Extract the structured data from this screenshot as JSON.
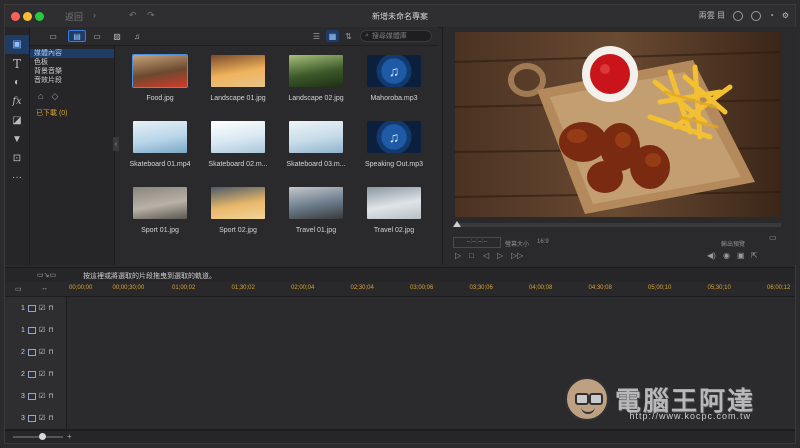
{
  "window": {
    "title": "新增未命名專案",
    "nav_back": "返回",
    "right_label": "兩雲 目",
    "icons": [
      "user-icon",
      "bell-icon",
      "gear-icon"
    ]
  },
  "left_tools": [
    {
      "name": "media-tool",
      "glyph": "▣"
    },
    {
      "name": "title-tool",
      "glyph": "T"
    },
    {
      "name": "transition-tool",
      "glyph": "◐"
    },
    {
      "name": "effects-tool",
      "glyph": "fx"
    },
    {
      "name": "pip-tool",
      "glyph": "◪"
    },
    {
      "name": "particle-tool",
      "glyph": "▼"
    },
    {
      "name": "export-tool",
      "glyph": "⊡"
    },
    {
      "name": "more-tool",
      "glyph": "···"
    }
  ],
  "library": {
    "search_placeholder": "搜尋媒體庫",
    "categories": [
      "媒體內容",
      "色板",
      "背景音樂",
      "音效片段"
    ],
    "downloaded": "已下載 (0)",
    "items": [
      {
        "name": "Food.jpg",
        "kind": "photo",
        "colors": [
          "#6b4a2f",
          "#c9a37a",
          "#d43a2a"
        ]
      },
      {
        "name": "Landscape 01.jpg",
        "kind": "photo",
        "colors": [
          "#f0b35c",
          "#7a4a2a",
          "#e6c48a"
        ]
      },
      {
        "name": "Landscape 02.jpg",
        "kind": "photo",
        "colors": [
          "#3d5a2a",
          "#a8c07a",
          "#1e2f15"
        ]
      },
      {
        "name": "Mahoroba.mp3",
        "kind": "music"
      },
      {
        "name": "Skateboard 01.mp4",
        "kind": "photo",
        "colors": [
          "#b9d6ea",
          "#e6f0f6",
          "#7aa6c4"
        ]
      },
      {
        "name": "Skateboard 02.m...",
        "kind": "photo",
        "colors": [
          "#d9e8f2",
          "#ffffff",
          "#a9c6da"
        ]
      },
      {
        "name": "Skateboard 03.m...",
        "kind": "photo",
        "colors": [
          "#c6dbe8",
          "#eef4f8",
          "#8fb3cc"
        ]
      },
      {
        "name": "Speaking Out.mp3",
        "kind": "music"
      },
      {
        "name": "Sport 01.jpg",
        "kind": "photo",
        "colors": [
          "#b8b2a8",
          "#8a857c",
          "#5a554d"
        ]
      },
      {
        "name": "Sport 02.jpg",
        "kind": "photo",
        "colors": [
          "#e8b86a",
          "#4a5a6a",
          "#f2d49a"
        ]
      },
      {
        "name": "Travel 01.jpg",
        "kind": "photo",
        "colors": [
          "#6a7a8a",
          "#c4c8cc",
          "#3a3a3a"
        ]
      },
      {
        "name": "Travel 02.jpg",
        "kind": "photo",
        "colors": [
          "#dfe4e8",
          "#8a96a0",
          "#b8c0c6"
        ]
      }
    ]
  },
  "preview": {
    "timecode": "--:--:--:--",
    "aspect_label": "螢幕大小",
    "aspect_value": "16:9",
    "right_label": "輸出預覽"
  },
  "timeline": {
    "hint": "按這裡或將選取的片段拖曳到選取的軌道。",
    "ticks": [
      "00;00;00",
      "00;00;30;00",
      "01;00;02",
      "01;30;02",
      "02;00;04",
      "02;30;04",
      "03;00;06",
      "03;30;06",
      "04;00;08",
      "04;30;08",
      "05;00;10",
      "05;30;10",
      "06;00;12"
    ],
    "tracks": [
      "1",
      "1",
      "2",
      "2",
      "3",
      "3"
    ]
  },
  "watermark": {
    "text": "電腦王阿達",
    "url": "http://www.kocpc.com.tw"
  }
}
